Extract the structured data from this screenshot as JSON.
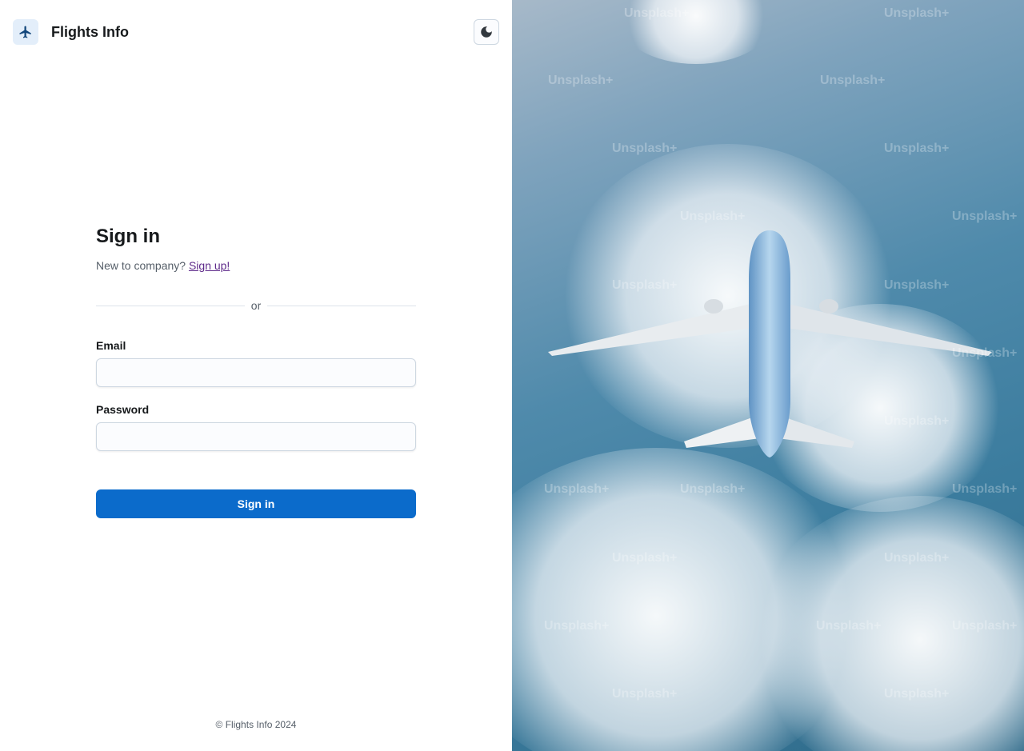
{
  "header": {
    "brand_icon": "airplane-icon",
    "brand_title": "Flights Info",
    "theme_toggle_icon": "moon-icon"
  },
  "form": {
    "title": "Sign in",
    "subtitle_prefix": "New to company?",
    "signup_link": "Sign up!",
    "divider_text": "or",
    "email_label": "Email",
    "email_value": "",
    "password_label": "Password",
    "password_value": "",
    "submit_label": "Sign in"
  },
  "footer": {
    "text": "© Flights Info 2024"
  },
  "hero": {
    "watermark": "Unsplash+",
    "image": "airplane-over-clouds-photo"
  },
  "colors": {
    "primary": "#0b6bcb",
    "link": "#5e2a8a",
    "brand_badge_bg": "#e3eefa",
    "brand_icon": "#12467b"
  }
}
